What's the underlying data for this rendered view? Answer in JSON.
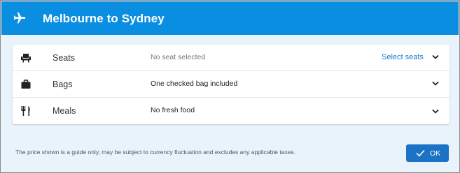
{
  "header": {
    "title": "Melbourne to Sydney",
    "icon": "plane-icon",
    "background": "#0a8ee1"
  },
  "extras": [
    {
      "name": "Seats",
      "value": "No seat selected",
      "action": "Select seats",
      "icon": "seat-icon"
    },
    {
      "name": "Bags",
      "value": "One checked bag included",
      "icon": "bag-icon"
    },
    {
      "name": "Meals",
      "value": "No fresh food",
      "icon": "meal-icon"
    }
  ],
  "footer": {
    "disclaimer": "The price shown is a guide only, may be subject to currency fluctuation and excludes any applicable taxes.",
    "ok_label": "OK"
  },
  "colors": {
    "link": "#1a7cc7",
    "ok_button": "#1a73c4",
    "panel_background": "#e8f3fb"
  }
}
